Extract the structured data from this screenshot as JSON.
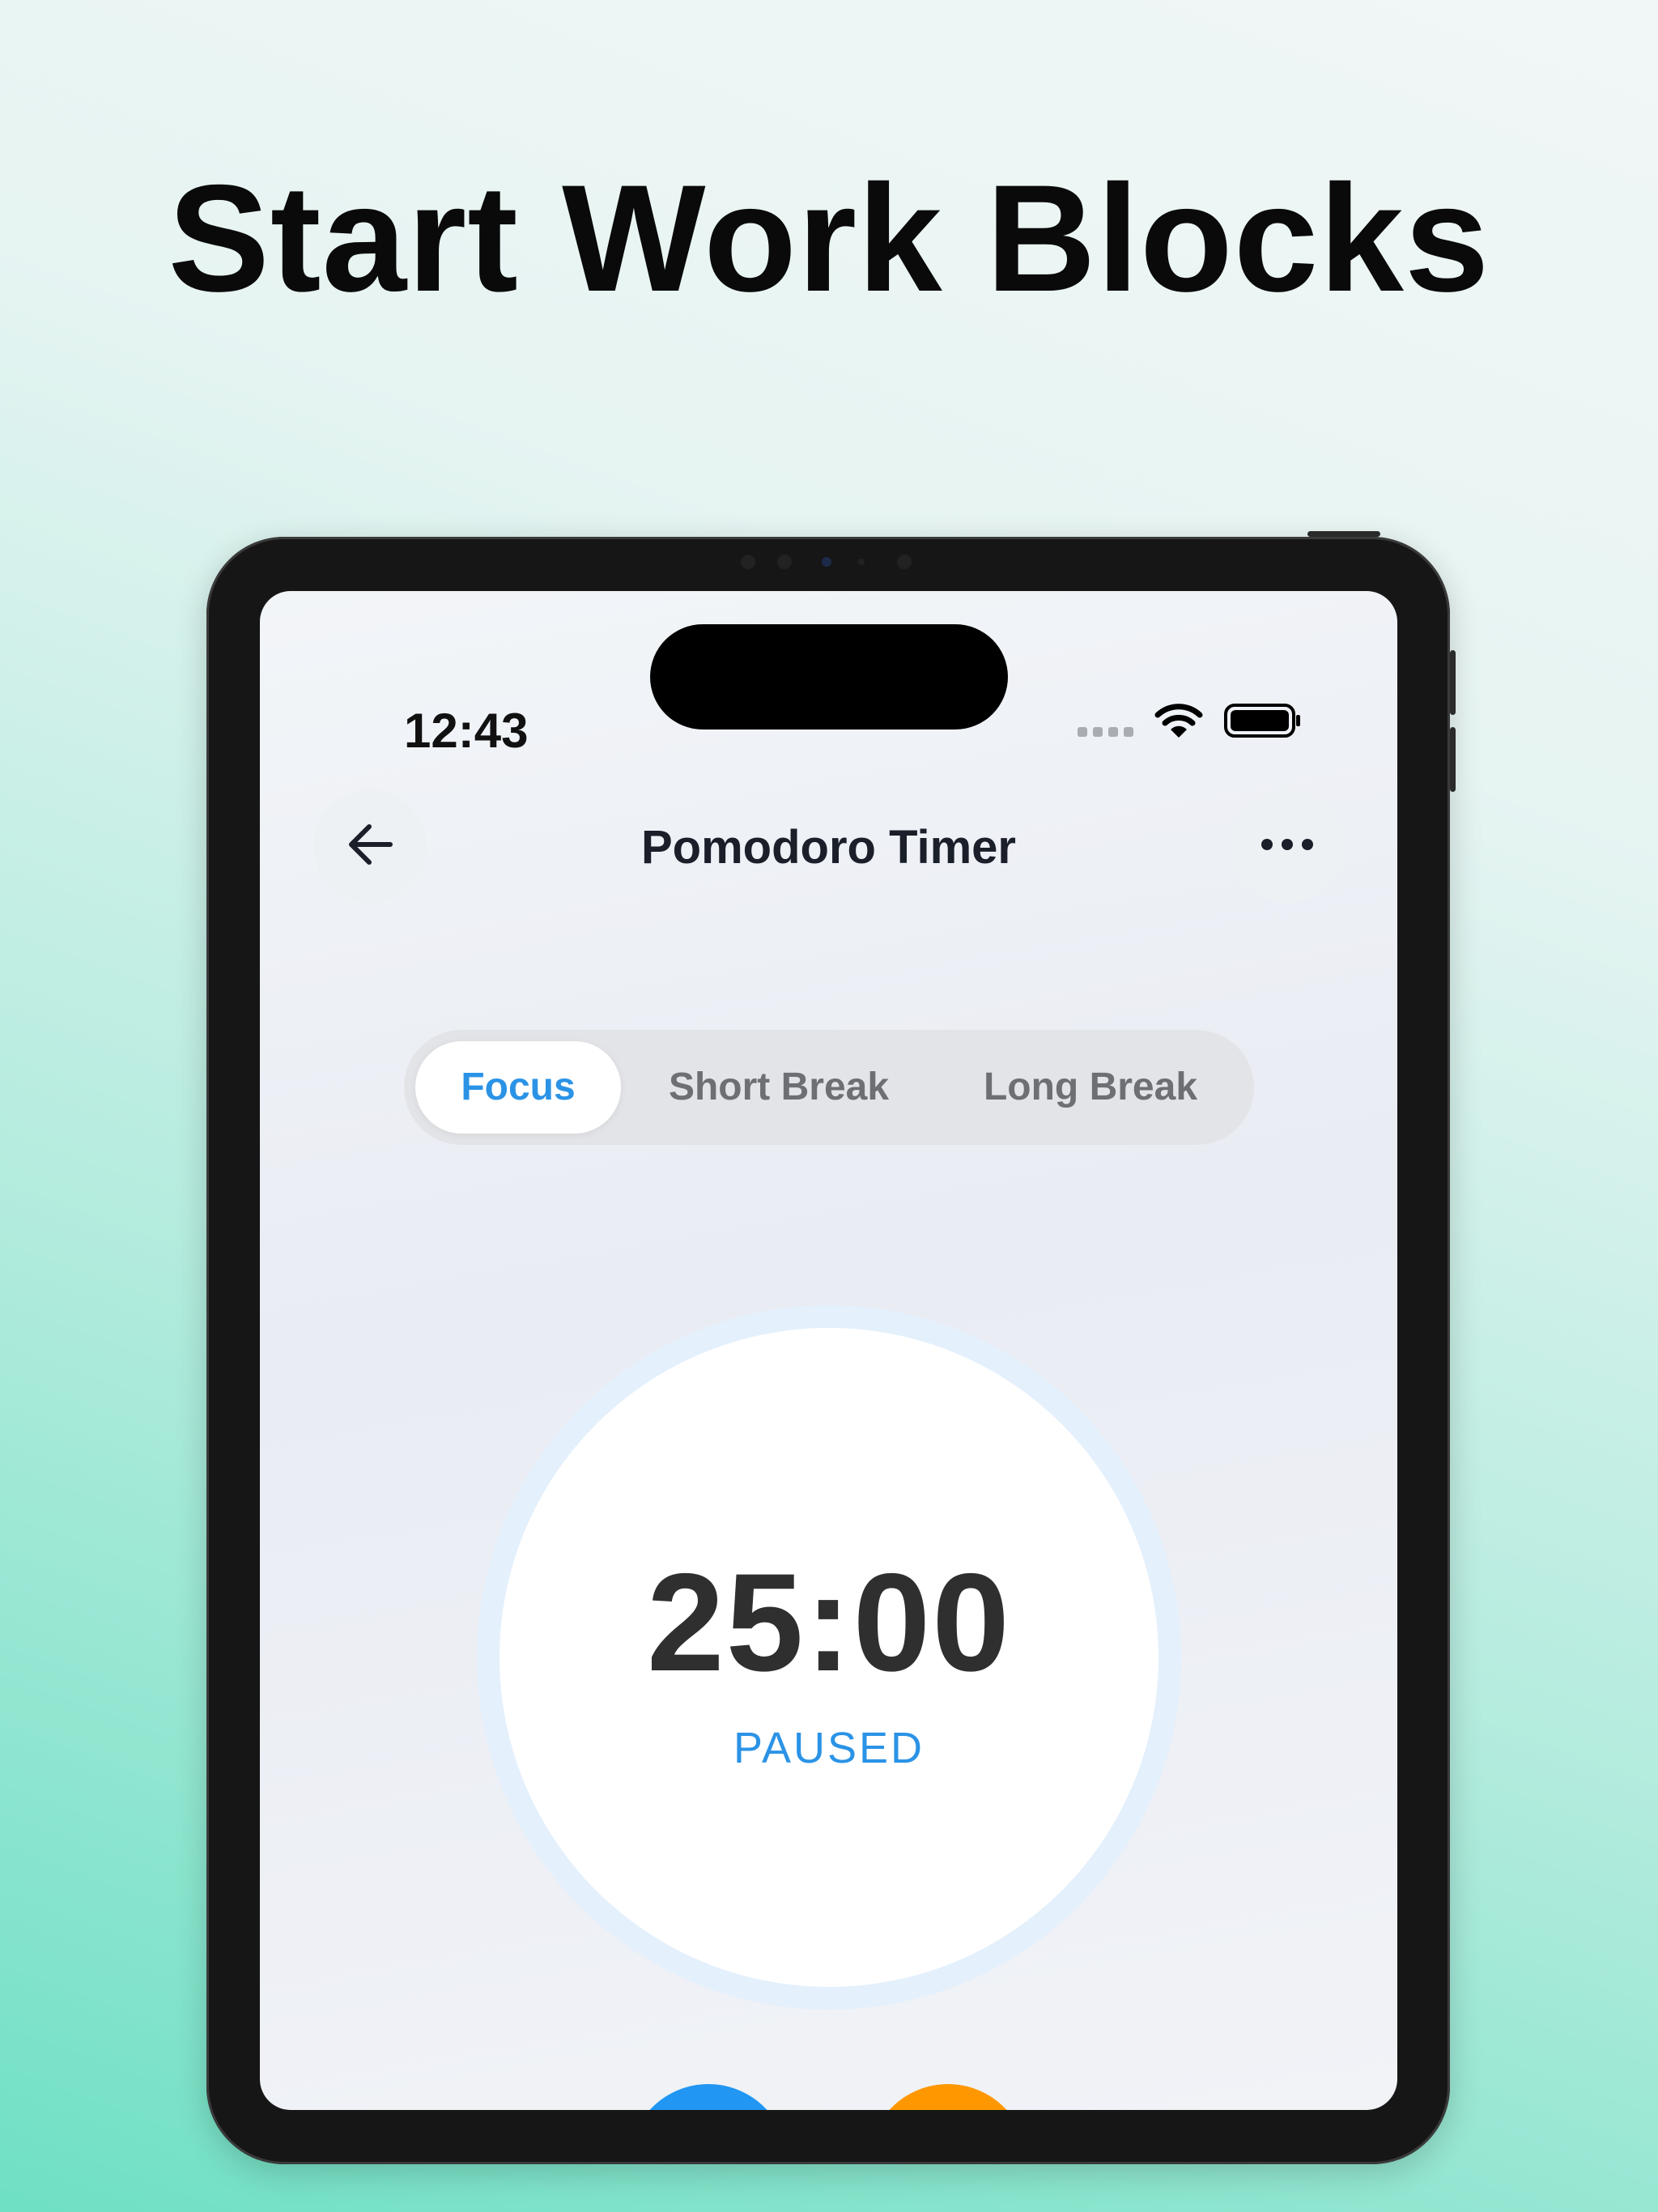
{
  "headline": "Start Work Blocks",
  "status_bar": {
    "time": "12:43"
  },
  "nav": {
    "title": "Pomodoro Timer"
  },
  "modes": [
    {
      "label": "Focus",
      "active": true
    },
    {
      "label": "Short Break",
      "active": false
    },
    {
      "label": "Long Break",
      "active": false
    }
  ],
  "timer": {
    "value": "25:00",
    "status": "PAUSED"
  },
  "colors": {
    "accent": "#2b93e6",
    "start_button": "#2196f3",
    "reset_button": "#ff9800"
  }
}
